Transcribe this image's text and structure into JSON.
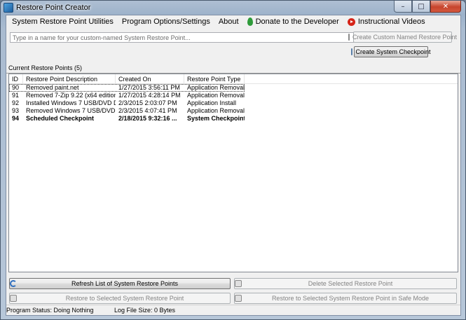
{
  "window": {
    "title": "Restore Point Creator",
    "minimize_glyph": "–",
    "maximize_glyph": "□",
    "close_glyph": "✕"
  },
  "menu": {
    "items": [
      {
        "label": "System Restore Point Utilities"
      },
      {
        "label": "Program Options/Settings"
      },
      {
        "label": "About"
      },
      {
        "label": "Donate to the Developer",
        "icon": "leaf-icon"
      },
      {
        "label": "Instructional Videos",
        "icon": "play-icon"
      }
    ]
  },
  "create": {
    "placeholder": "Type in a name for your custom-named System Restore Point...",
    "value": "",
    "custom_button": "Create Custom Named Restore Point",
    "checkpoint_button": "Create System Checkpoint"
  },
  "restore_points": {
    "label": "Current Restore Points (5)",
    "columns": [
      "ID",
      "Restore Point Description",
      "Created On",
      "Restore Point Type"
    ],
    "rows": [
      {
        "id": "90",
        "desc": "Removed paint.net",
        "created": "1/27/2015 3:56:11 PM",
        "type": "Application Removal"
      },
      {
        "id": "91",
        "desc": "Removed 7-Zip 9.22 (x64 edition)",
        "created": "1/27/2015 4:28:14 PM",
        "type": "Application Removal"
      },
      {
        "id": "92",
        "desc": "Installed Windows 7 USB/DVD Do...",
        "created": "2/3/2015 2:03:07 PM",
        "type": "Application Install"
      },
      {
        "id": "93",
        "desc": "Removed Windows 7 USB/DVD Do...",
        "created": "2/3/2015 4:07:41 PM",
        "type": "Application Removal"
      },
      {
        "id": "94",
        "desc": "Scheduled Checkpoint",
        "created": "2/18/2015 9:32:16 ...",
        "type": "System Checkpoint"
      }
    ]
  },
  "actions": {
    "refresh": "Refresh List of System Restore Points",
    "delete": "Delete Selected Restore Point",
    "restore": "Restore to Selected System Restore Point",
    "restore_safe": "Restore to Selected System Restore Point in Safe Mode"
  },
  "status": {
    "program_status": "Program Status:  Doing Nothing",
    "log_size": "Log File Size:  0 Bytes"
  }
}
